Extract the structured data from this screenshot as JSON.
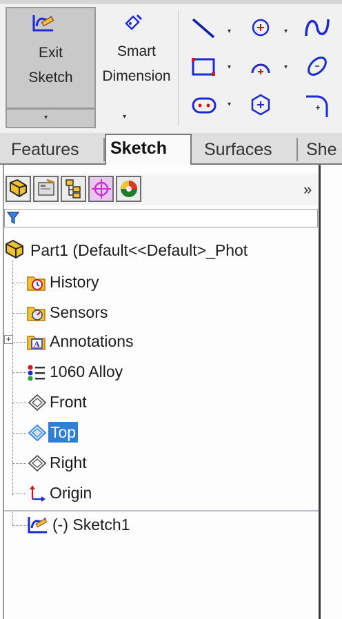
{
  "ribbon": {
    "exit_sketch": {
      "line1": "Exit",
      "line2": "Sketch"
    },
    "smart_dimension": {
      "line1": "Smart",
      "line2": "Dimension"
    },
    "caret": "▾"
  },
  "tabs": [
    "Features",
    "Sketch",
    "Surfaces",
    "She"
  ],
  "panel": {
    "more": "»"
  },
  "tree": {
    "root": "Part1  (Default<<Default>_Phot",
    "items": [
      "History",
      "Sensors",
      "Annotations",
      "1060 Alloy",
      "Front",
      "Top",
      "Right",
      "Origin"
    ],
    "sketch": "(-) Sketch1",
    "plus": "+"
  },
  "colors": {
    "accent": "#2f7fd6",
    "sketch_blue": "#1a2bd6",
    "sketch_red": "#d8131f"
  }
}
